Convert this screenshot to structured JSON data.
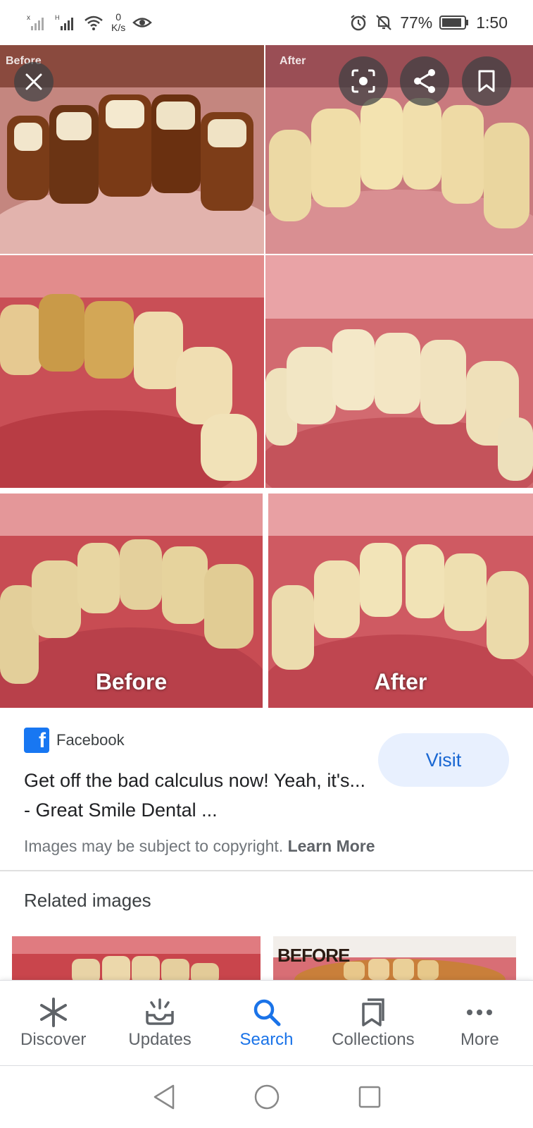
{
  "status_bar": {
    "network_speed_value": "0",
    "network_speed_unit": "K/s",
    "battery": "77%",
    "time": "1:50"
  },
  "hero": {
    "labels": {
      "before": "Before",
      "after": "After"
    },
    "tags": {
      "before": "Before",
      "after": "After"
    },
    "buttons": [
      "close-icon",
      "lens-icon",
      "share-icon",
      "bookmark-icon"
    ]
  },
  "result": {
    "source": "Facebook",
    "title": "Get off the bad calculus now! Yeah, it's... - Great Smile Dental ...",
    "visit_label": "Visit",
    "copyright_text": "Images may be subject to copyright.",
    "learn_more": "Learn More"
  },
  "related": {
    "heading": "Related images",
    "items": [
      {
        "tag": ""
      },
      {
        "tag": "BEFORE"
      }
    ]
  },
  "bottom_nav": {
    "items": [
      {
        "label": "Discover",
        "icon": "asterisk-icon"
      },
      {
        "label": "Updates",
        "icon": "updates-icon"
      },
      {
        "label": "Search",
        "icon": "search-icon",
        "active": true
      },
      {
        "label": "Collections",
        "icon": "collections-icon"
      },
      {
        "label": "More",
        "icon": "more-icon"
      }
    ]
  },
  "colors": {
    "accent": "#1a73e8",
    "visit_bg": "#e8f0fe",
    "facebook": "#1877f2"
  }
}
